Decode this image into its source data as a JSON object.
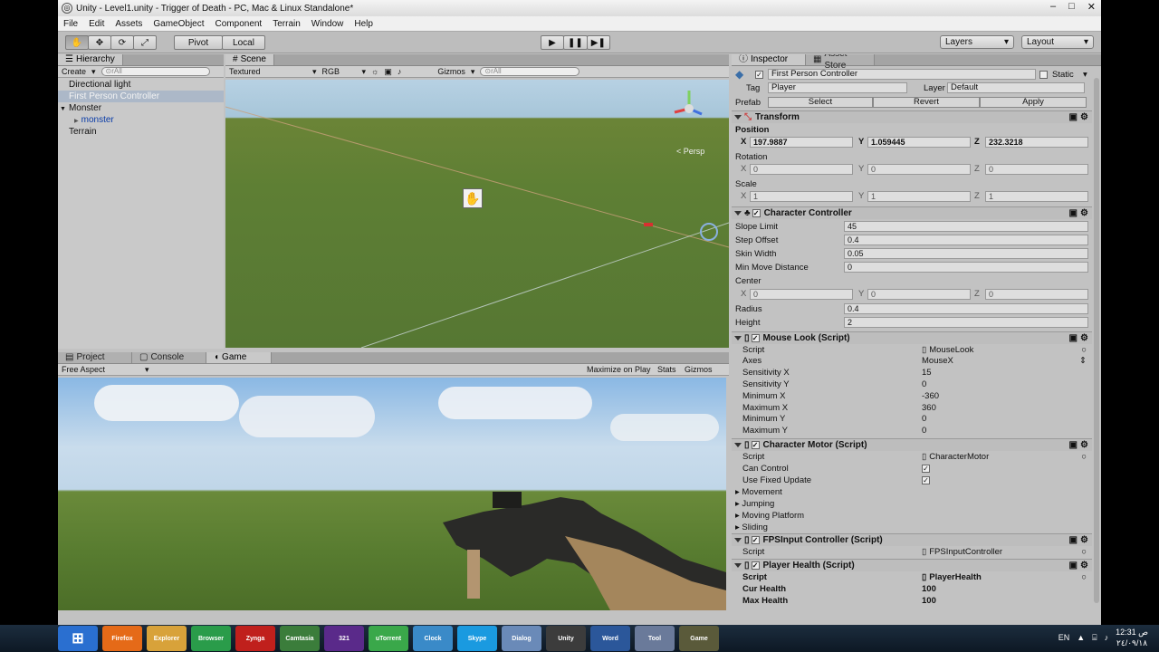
{
  "window": {
    "title": "Unity - Level1.unity - Trigger of Death - PC, Mac & Linux Standalone*",
    "min": "–",
    "max": "□",
    "close": "✕"
  },
  "menu": [
    "File",
    "Edit",
    "Assets",
    "GameObject",
    "Component",
    "Terrain",
    "Window",
    "Help"
  ],
  "toolbar": {
    "tools": [
      "✋",
      "✥",
      "⟳",
      "⤢"
    ],
    "pivot": "Pivot",
    "local": "Local",
    "play": "▶",
    "pause": "❚❚",
    "step": "▶❚",
    "layers": "Layers",
    "layout": "Layout"
  },
  "hierarchy": {
    "tab": "Hierarchy",
    "create": "Create",
    "search": "⊙rAll",
    "items": [
      {
        "label": "Directional light",
        "level": 0,
        "selected": false
      },
      {
        "label": "First Person Controller",
        "level": 0,
        "selected": true
      },
      {
        "label": "Monster",
        "level": 0,
        "selected": false,
        "arrow": "▼"
      },
      {
        "label": "monster",
        "level": 1,
        "selected": false,
        "arrow": "▶"
      },
      {
        "label": "Terrain",
        "level": 0,
        "selected": false
      }
    ]
  },
  "scene": {
    "tab": "Scene",
    "shading": "Textured",
    "render": "RGB",
    "gizmos": "Gizmos",
    "search": "⊙rAll",
    "persp": "Persp"
  },
  "bottom": {
    "tabs": [
      "Project",
      "Console",
      "Game"
    ],
    "aspect": "Free Aspect",
    "maximize": "Maximize on Play",
    "stats": "Stats",
    "gizmos": "Gizmos"
  },
  "inspector": {
    "tabs": [
      "Inspector",
      "Asset Store"
    ],
    "object_name": "First Person Controller",
    "static": "Static",
    "tag_label": "Tag",
    "tag": "Player",
    "layer_label": "Layer",
    "layer": "Default",
    "prefab_label": "Prefab",
    "prefab_select": "Select",
    "prefab_revert": "Revert",
    "prefab_apply": "Apply",
    "transform": {
      "title": "Transform",
      "position_label": "Position",
      "rotation_label": "Rotation",
      "scale_label": "Scale",
      "position": [
        "197.9887",
        "1.059445",
        "232.3218"
      ],
      "rotation": [
        "0",
        "0",
        "0"
      ],
      "scale": [
        "1",
        "1",
        "1"
      ]
    },
    "cc": {
      "title": "Character Controller",
      "slope_label": "Slope Limit",
      "slope": "45",
      "step_label": "Step Offset",
      "step": "0.4",
      "skin_label": "Skin Width",
      "skin": "0.05",
      "minmove_label": "Min Move Distance",
      "minmove": "0",
      "center_label": "Center",
      "center": [
        "0",
        "0",
        "0"
      ],
      "radius_label": "Radius",
      "radius": "0.4",
      "height_label": "Height",
      "height": "2"
    },
    "mouselook": {
      "title": "Mouse Look (Script)",
      "rows": [
        {
          "label": "Script",
          "value": "MouseLook",
          "ref": true
        },
        {
          "label": "Axes",
          "value": "MouseX",
          "ref": false
        },
        {
          "label": "Sensitivity X",
          "value": "15",
          "ref": false
        },
        {
          "label": "Sensitivity Y",
          "value": "0",
          "ref": false
        },
        {
          "label": "Minimum X",
          "value": "-360",
          "ref": false
        },
        {
          "label": "Maximum X",
          "value": "360",
          "ref": false
        },
        {
          "label": "Minimum Y",
          "value": "0",
          "ref": false
        },
        {
          "label": "Maximum Y",
          "value": "0",
          "ref": false
        }
      ]
    },
    "motor": {
      "title": "Character Motor (Script)",
      "script_label": "Script",
      "script": "CharacterMotor",
      "can_control": "Can Control",
      "fixed_update": "Use Fixed Update",
      "sections": [
        "Movement",
        "Jumping",
        "Moving Platform",
        "Sliding"
      ]
    },
    "fpsinput": {
      "title": "FPSInput Controller (Script)",
      "script_label": "Script",
      "script": "FPSInputController"
    },
    "health": {
      "title": "Player Health (Script)",
      "script_label": "Script",
      "script": "PlayerHealth",
      "cur_label": "Cur Health",
      "cur": "100",
      "max_label": "Max Health",
      "max": "100"
    }
  },
  "taskbar": {
    "apps": [
      "⊞",
      "Firefox",
      "Explorer",
      "Browser",
      "Zynga",
      "Camtasia",
      "321",
      "uTorrent",
      "Clock",
      "Skype",
      "Dialog",
      "Unity",
      "Word",
      "Tool",
      "Game"
    ],
    "lang": "EN",
    "time": "12:31 ص",
    "date": "٢٤/٠٩/١٨"
  }
}
